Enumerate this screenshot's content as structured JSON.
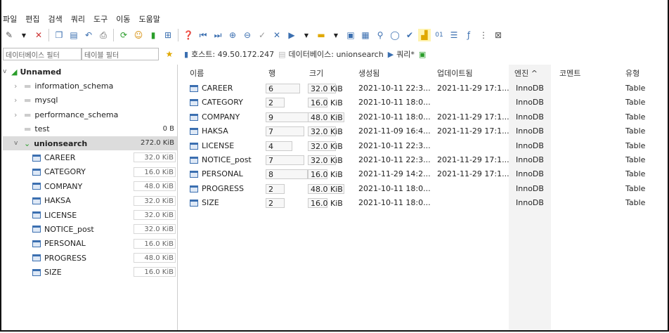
{
  "menu": [
    "파일",
    "편집",
    "검색",
    "쿼리",
    "도구",
    "이동",
    "도움말"
  ],
  "filters": {
    "db_filter": "데이터베이스 필터",
    "table_filter": "테이블 필터"
  },
  "tabs": {
    "host": "호스트: 49.50.172.247",
    "database": "데이터베이스: unionsearch",
    "query": "쿼리*"
  },
  "tree": {
    "root": "Unnamed",
    "databases": [
      {
        "name": "information_schema",
        "size": ""
      },
      {
        "name": "mysql",
        "size": ""
      },
      {
        "name": "performance_schema",
        "size": ""
      },
      {
        "name": "test",
        "size": "0 B"
      },
      {
        "name": "unionsearch",
        "size": "272.0 KiB"
      }
    ],
    "tables": [
      {
        "name": "CAREER",
        "size": "32.0 KiB"
      },
      {
        "name": "CATEGORY",
        "size": "16.0 KiB"
      },
      {
        "name": "COMPANY",
        "size": "48.0 KiB"
      },
      {
        "name": "HAKSA",
        "size": "32.0 KiB"
      },
      {
        "name": "LICENSE",
        "size": "32.0 KiB"
      },
      {
        "name": "NOTICE_post",
        "size": "32.0 KiB"
      },
      {
        "name": "PERSONAL",
        "size": "16.0 KiB"
      },
      {
        "name": "PROGRESS",
        "size": "48.0 KiB"
      },
      {
        "name": "SIZE",
        "size": "16.0 KiB"
      }
    ]
  },
  "grid": {
    "headers": [
      "이름",
      "행",
      "크기",
      "생성됨",
      "업데이트됨",
      "엔진 ^",
      "코멘트",
      "유형"
    ],
    "rows": [
      [
        "CAREER",
        "6",
        "32.0 KiB",
        "2021-10-11 22:3...",
        "2021-11-29 17:1...",
        "InnoDB",
        "",
        "Table"
      ],
      [
        "CATEGORY",
        "2",
        "16.0 KiB",
        "2021-10-11 18:0...",
        "",
        "InnoDB",
        "",
        "Table"
      ],
      [
        "COMPANY",
        "9",
        "48.0 KiB",
        "2021-10-11 18:0...",
        "2021-11-29 17:1...",
        "InnoDB",
        "",
        "Table"
      ],
      [
        "HAKSA",
        "7",
        "32.0 KiB",
        "2021-11-09 16:4...",
        "2021-11-29 17:1...",
        "InnoDB",
        "",
        "Table"
      ],
      [
        "LICENSE",
        "4",
        "32.0 KiB",
        "2021-10-11 22:3...",
        "",
        "InnoDB",
        "",
        "Table"
      ],
      [
        "NOTICE_post",
        "7",
        "32.0 KiB",
        "2021-10-11 22:3...",
        "2021-11-29 17:1...",
        "InnoDB",
        "",
        "Table"
      ],
      [
        "PERSONAL",
        "8",
        "16.0 KiB",
        "2021-11-29 14:2...",
        "2021-11-29 17:1...",
        "InnoDB",
        "",
        "Table"
      ],
      [
        "PROGRESS",
        "2",
        "48.0 KiB",
        "2021-10-11 18:0...",
        "",
        "InnoDB",
        "",
        "Table"
      ],
      [
        "SIZE",
        "2",
        "16.0 KiB",
        "2021-10-11 18:0...",
        "",
        "InnoDB",
        "",
        "Table"
      ]
    ]
  }
}
